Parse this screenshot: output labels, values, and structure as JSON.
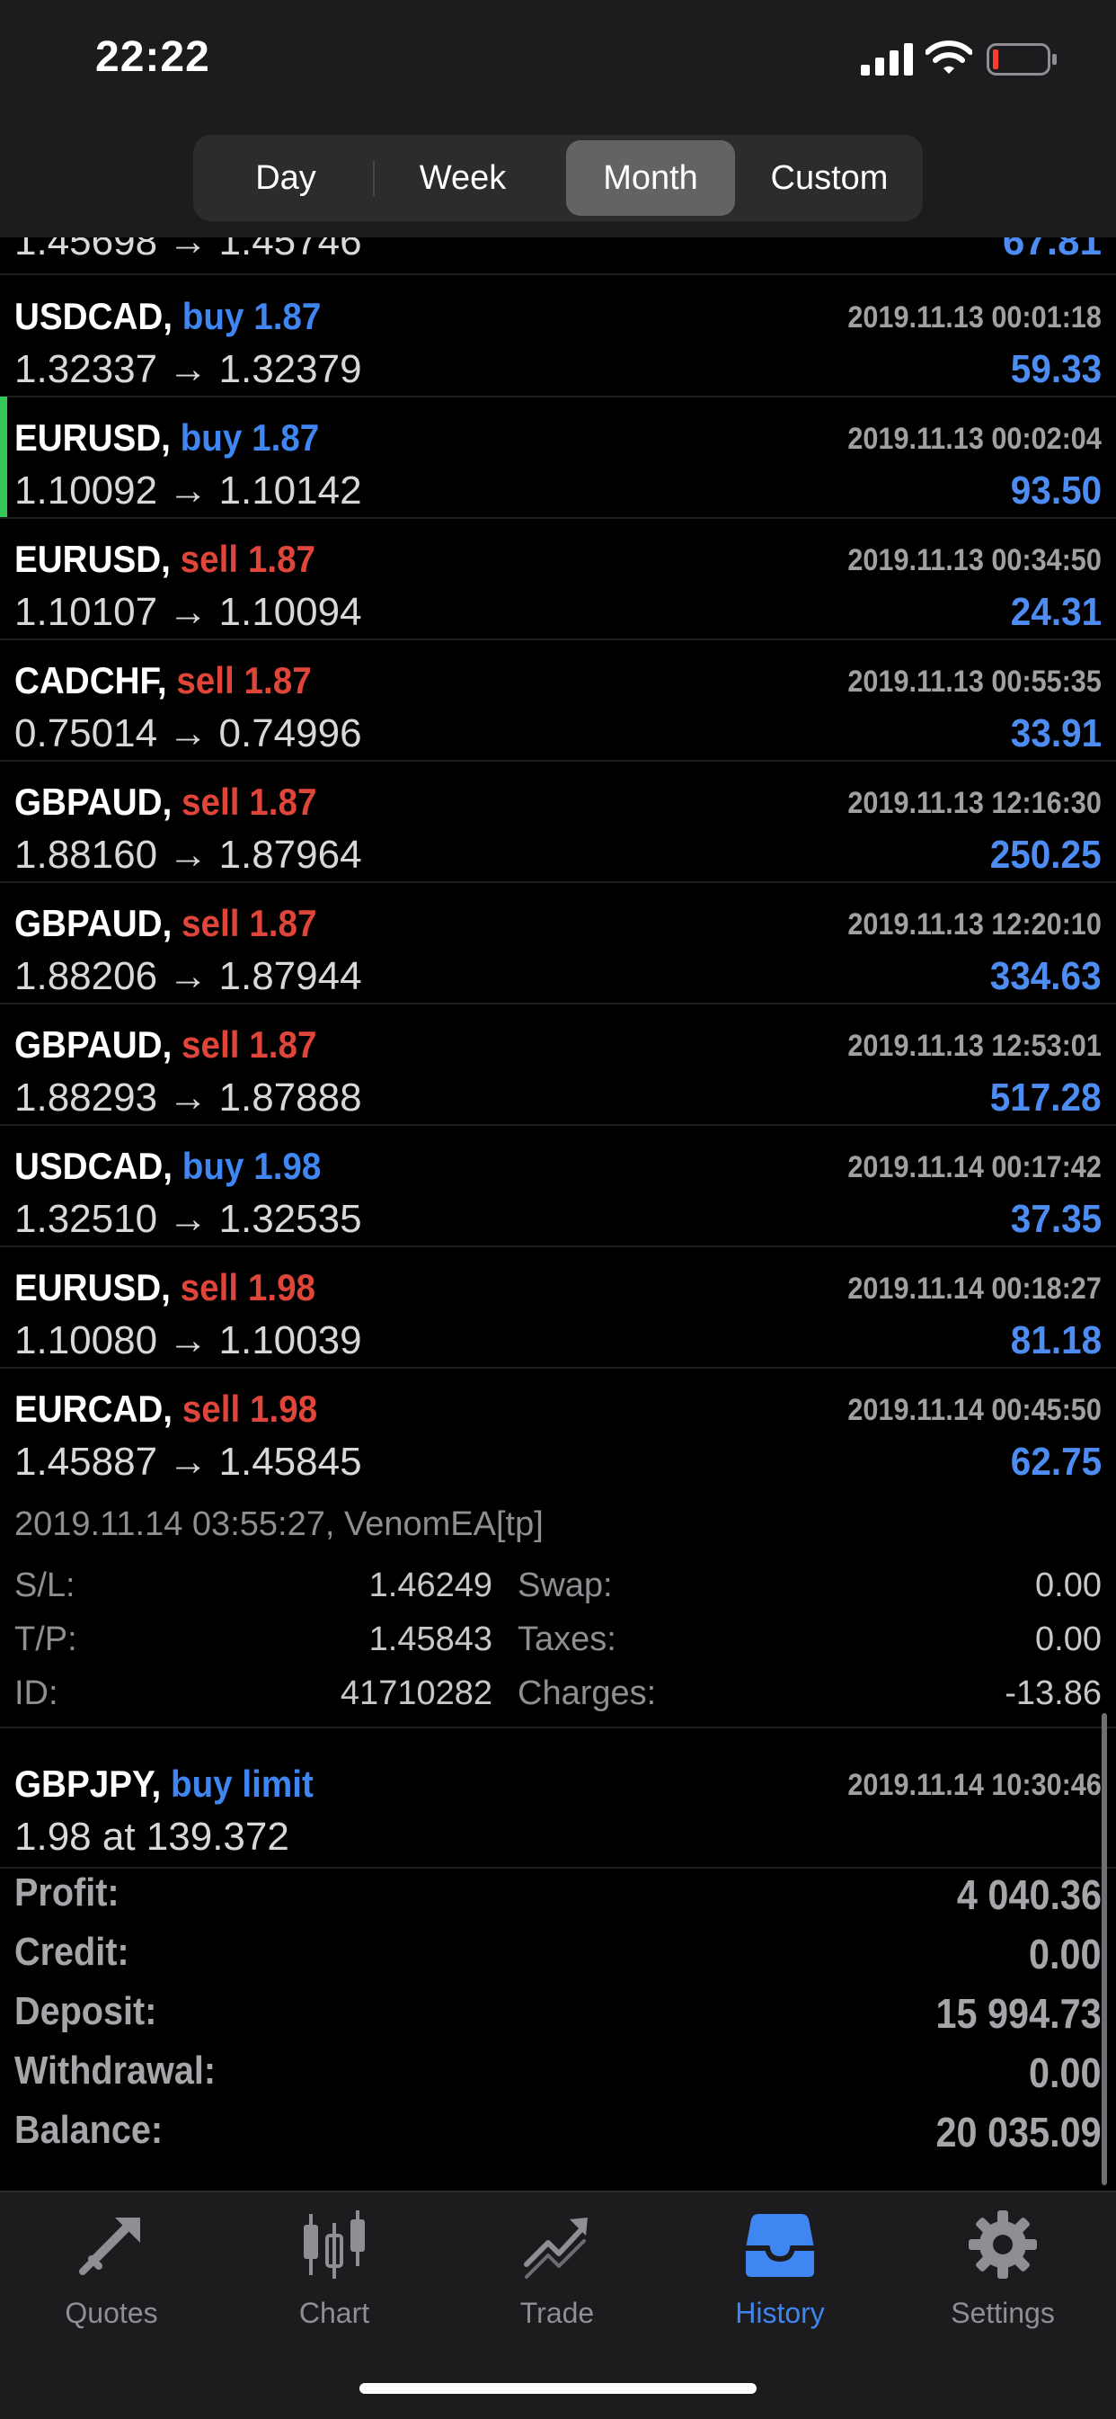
{
  "status_bar": {
    "time": "22:22"
  },
  "period_tabs": [
    {
      "label": "Day",
      "active": false
    },
    {
      "label": "Week",
      "active": false
    },
    {
      "label": "Month",
      "active": true
    },
    {
      "label": "Custom",
      "active": false
    }
  ],
  "partial_row": {
    "prices": "1.45698 → 1.45746",
    "profit": "67.81"
  },
  "deals": [
    {
      "symbol": "USDCAD,",
      "side": "buy",
      "volume": "1.87",
      "datetime": "2019.11.13 00:01:18",
      "prices": "1.32337 → 1.32379",
      "profit": "59.33",
      "accent": false
    },
    {
      "symbol": "EURUSD,",
      "side": "buy",
      "volume": "1.87",
      "datetime": "2019.11.13 00:02:04",
      "prices": "1.10092 → 1.10142",
      "profit": "93.50",
      "accent": true
    },
    {
      "symbol": "EURUSD,",
      "side": "sell",
      "volume": "1.87",
      "datetime": "2019.11.13 00:34:50",
      "prices": "1.10107 → 1.10094",
      "profit": "24.31",
      "accent": false
    },
    {
      "symbol": "CADCHF,",
      "side": "sell",
      "volume": "1.87",
      "datetime": "2019.11.13 00:55:35",
      "prices": "0.75014 → 0.74996",
      "profit": "33.91",
      "accent": false
    },
    {
      "symbol": "GBPAUD,",
      "side": "sell",
      "volume": "1.87",
      "datetime": "2019.11.13 12:16:30",
      "prices": "1.88160 → 1.87964",
      "profit": "250.25",
      "accent": false
    },
    {
      "symbol": "GBPAUD,",
      "side": "sell",
      "volume": "1.87",
      "datetime": "2019.11.13 12:20:10",
      "prices": "1.88206 → 1.87944",
      "profit": "334.63",
      "accent": false
    },
    {
      "symbol": "GBPAUD,",
      "side": "sell",
      "volume": "1.87",
      "datetime": "2019.11.13 12:53:01",
      "prices": "1.88293 → 1.87888",
      "profit": "517.28",
      "accent": false
    },
    {
      "symbol": "USDCAD,",
      "side": "buy",
      "volume": "1.98",
      "datetime": "2019.11.14 00:17:42",
      "prices": "1.32510 → 1.32535",
      "profit": "37.35",
      "accent": false
    },
    {
      "symbol": "EURUSD,",
      "side": "sell",
      "volume": "1.98",
      "datetime": "2019.11.14 00:18:27",
      "prices": "1.10080 → 1.10039",
      "profit": "81.18",
      "accent": false
    },
    {
      "symbol": "EURCAD,",
      "side": "sell",
      "volume": "1.98",
      "datetime": "2019.11.14 00:45:50",
      "prices": "1.45887 → 1.45845",
      "profit": "62.75",
      "accent": false
    }
  ],
  "deal_detail": {
    "note": "2019.11.14 03:55:27, VenomEA[tp]",
    "sl_label": "S/L:",
    "sl": "1.46249",
    "tp_label": "T/P:",
    "tp": "1.45843",
    "id_label": "ID:",
    "id": "41710282",
    "swap_label": "Swap:",
    "swap": "0.00",
    "taxes_label": "Taxes:",
    "taxes": "0.00",
    "charges_label": "Charges:",
    "charges": "-13.86"
  },
  "order": {
    "symbol": "GBPJPY,",
    "type": "buy limit",
    "datetime": "2019.11.14 10:30:46",
    "desc": "1.98 at 139.372"
  },
  "summary": [
    {
      "label": "Profit:",
      "value": "4 040.36"
    },
    {
      "label": "Credit:",
      "value": "0.00"
    },
    {
      "label": "Deposit:",
      "value": "15 994.73"
    },
    {
      "label": "Withdrawal:",
      "value": "0.00"
    },
    {
      "label": "Balance:",
      "value": "20 035.09"
    }
  ],
  "tabbar": [
    {
      "label": "Quotes",
      "icon": "quotes-icon",
      "active": false
    },
    {
      "label": "Chart",
      "icon": "chart-icon",
      "active": false
    },
    {
      "label": "Trade",
      "icon": "trade-icon",
      "active": false
    },
    {
      "label": "History",
      "icon": "history-icon",
      "active": true
    },
    {
      "label": "Settings",
      "icon": "settings-icon",
      "active": false
    }
  ],
  "colors": {
    "buy": "#3f86f2",
    "sell": "#e0453a",
    "profit": "#4d8df3",
    "accent_green": "#34c759",
    "active_tab": "#3f86f2"
  }
}
